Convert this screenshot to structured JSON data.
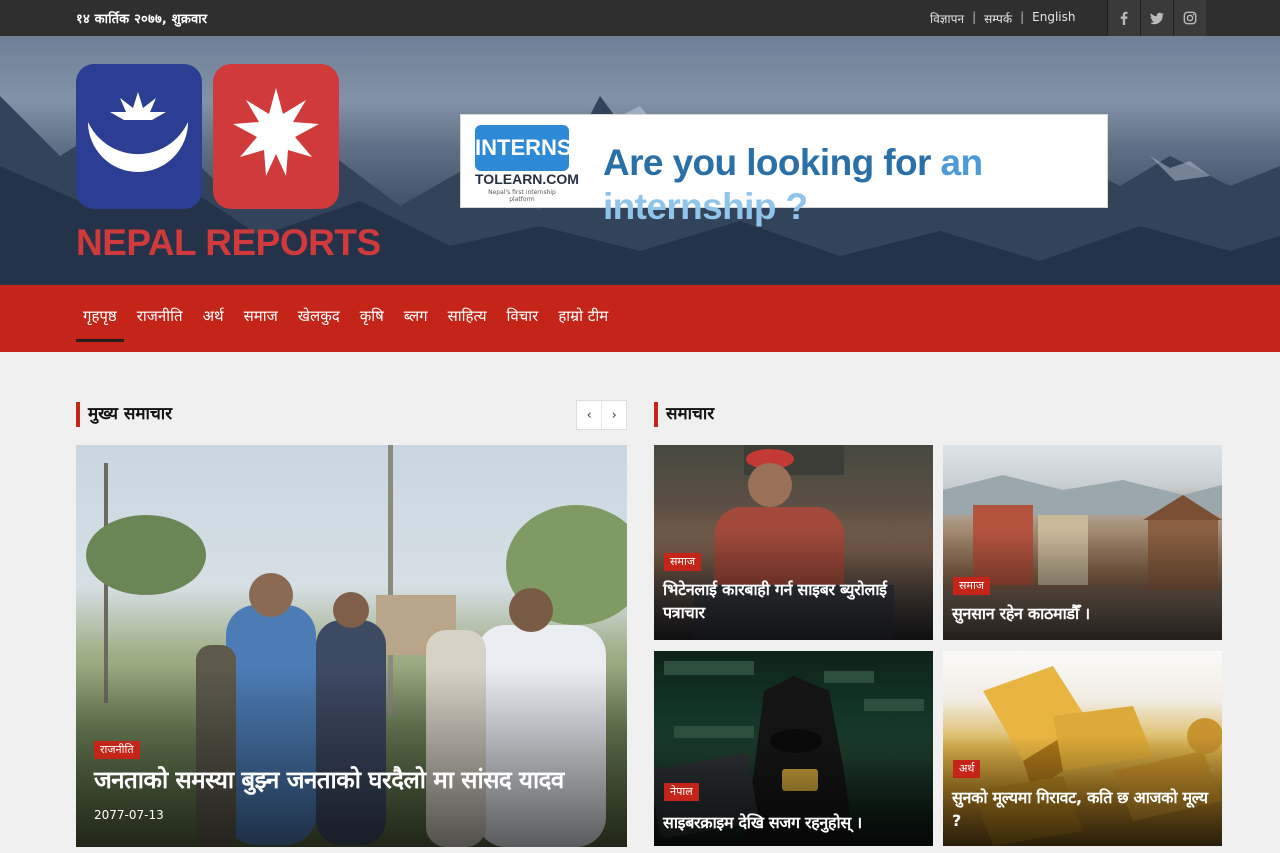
{
  "topbar": {
    "date": "१४ कार्तिक २०७७, शुक्रवार",
    "links": [
      "विज्ञापन",
      "सम्पर्क",
      "English"
    ],
    "separator": "|",
    "socials": [
      {
        "name": "facebook-icon",
        "glyph": "f"
      },
      {
        "name": "twitter-icon",
        "glyph": "t"
      },
      {
        "name": "instagram-icon",
        "glyph": "i"
      }
    ]
  },
  "header": {
    "logo_text": "NEPAL REPORTS",
    "ad": {
      "logo_top": "INTERNS",
      "logo_bottom": "TOLEARN.COM",
      "logo_tagline": "Nepal's first internship platform",
      "text_a": "Are you looking for",
      "text_b": "an",
      "text_c": "internship ?"
    }
  },
  "nav": {
    "items": [
      "गृहपृष्ठ",
      "राजनीति",
      "अर्थ",
      "समाज",
      "खेलकुद",
      "कृषि",
      "ब्लग",
      "साहित्य",
      "विचार",
      "हाम्रो टीम"
    ],
    "active": 0
  },
  "sections": {
    "main_heading": "मुख्य समाचार",
    "news_heading": "समाचार",
    "prev": "‹",
    "next": "›"
  },
  "featured": {
    "category": "राजनीति",
    "title": "जनताको समस्या बुझ्न जनताको घरदैलो मा सांसद यादव",
    "date": "2077-07-13"
  },
  "cards": [
    {
      "category": "समाज",
      "title": "भिटेनलाई कारबाही गर्न साइबर ब्युरोलाई पत्राचार"
    },
    {
      "category": "समाज",
      "title": "सुनसान रहेन काठमाडौँ ।"
    },
    {
      "category": "नेपाल",
      "title": "साइबरक्राइम देखि सजग रहनुहोस् ।"
    },
    {
      "category": "अर्थ",
      "title": "सुनको मूल्यमा गिरावट, कति छ आजको मूल्य ?"
    }
  ],
  "colors": {
    "brand_red": "#c52518",
    "topbar": "#2f2f2f",
    "logo_blue": "#2c3e93",
    "logo_red": "#d03a3a"
  }
}
